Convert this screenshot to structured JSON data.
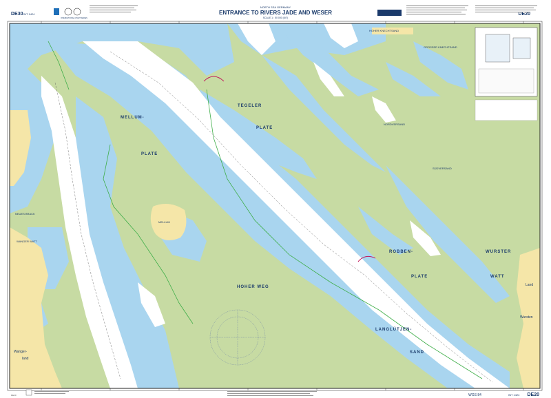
{
  "header": {
    "region": "NORTH SEA  GERMANY",
    "title": "ENTRANCE TO RIVERS JADE AND WESER",
    "scale": "SCALE 1 : 50 000 (54°)",
    "chart_no_left": "DE30",
    "chart_no_right": "DE20",
    "admiralty": "ADMIRALTY",
    "org": "INTERNATIONAL CHART SERIES"
  },
  "footer": {
    "datum": "WGS 84",
    "int": "INT 1424",
    "chart_no": "DE20"
  },
  "place_names": {
    "mellum": "MELLUM-",
    "plate1": "PLATE",
    "tegeler": "TEGELER",
    "plate2": "PLATE",
    "robben": "ROBBEN-",
    "plate3": "PLATE",
    "hoher_weg": "HOHER WEG",
    "langlutjen": "LANGLÜTJEN-",
    "sand": "SAND",
    "wurster": "WURSTER",
    "watt": "WATT",
    "hoher_knechtsand": "HOHER KNECHTSAND",
    "mellum_island": "MELLUM",
    "neues_brack": "NEUES BRACK",
    "wanger_watt": "WANGER WATT",
    "wanger": "Wanger-",
    "land": "land",
    "land_right": "Land",
    "wursten": "Wursten",
    "nordverand": "NORDVERSAND",
    "sudverand": "SÜDVERSAND",
    "grosser_knechtsand": "GROSSER KNECHTSAND"
  },
  "colors": {
    "land": "#f5e6a8",
    "drying": "#c7dba3",
    "shallow": "#a9d5ef",
    "deep": "#ffffff",
    "green_line": "#3fae49",
    "magenta": "#c2185b"
  }
}
